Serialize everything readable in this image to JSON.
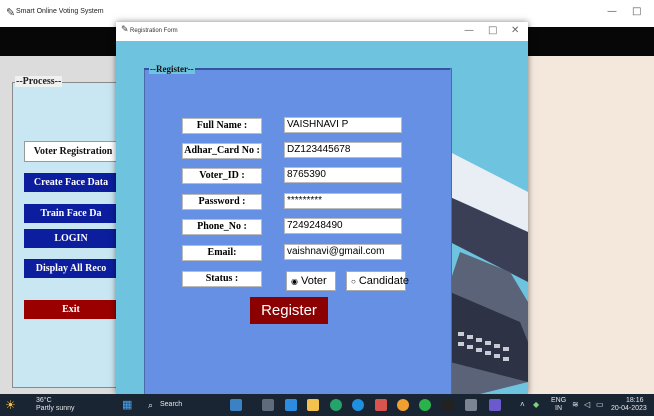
{
  "main_window": {
    "title": "Smart Online Voting System",
    "minimize_glyph": "—",
    "maximize_glyph": "□"
  },
  "process": {
    "label": "--Process--",
    "buttons": [
      {
        "label": "Voter Registration"
      },
      {
        "label": "Create Face Data"
      },
      {
        "label": "Train Face Da"
      },
      {
        "label": "LOGIN"
      },
      {
        "label": "Display All Reco"
      },
      {
        "label": "Exit"
      }
    ]
  },
  "registration_window": {
    "title": "Registration Form",
    "minimize_glyph": "—",
    "maximize_glyph": "□",
    "close_glyph": "✕",
    "frame_label": "--Register--",
    "fields": [
      {
        "label": "Full Name :",
        "value": "VAISHNAVI P"
      },
      {
        "label": "Adhar_Card No :",
        "value": "DZ123445678"
      },
      {
        "label": "Voter_ID :",
        "value": "8765390"
      },
      {
        "label": "Password :",
        "value": "*********"
      },
      {
        "label": "Phone_No :",
        "value": "7249248490"
      },
      {
        "label": "Email:",
        "value": "vaishnavi@gmail.com"
      }
    ],
    "status_label": "Status :",
    "status_options": [
      {
        "label": "Voter",
        "selected": true
      },
      {
        "label": "Candidate",
        "selected": false
      }
    ],
    "register_button": "Register"
  },
  "taskbar": {
    "weather_temp": "36°C",
    "weather_desc": "Partly sunny",
    "search_label": "Search",
    "language": "ENG",
    "region": "IN",
    "time": "18:16",
    "date": "20-04-2023"
  },
  "colors": {
    "frame_blue": "#6690e3",
    "window_cyan": "#6ec3df",
    "button_navy": "#0c1e9e",
    "exit_red": "#9a0000",
    "register_red": "#8b0000"
  }
}
